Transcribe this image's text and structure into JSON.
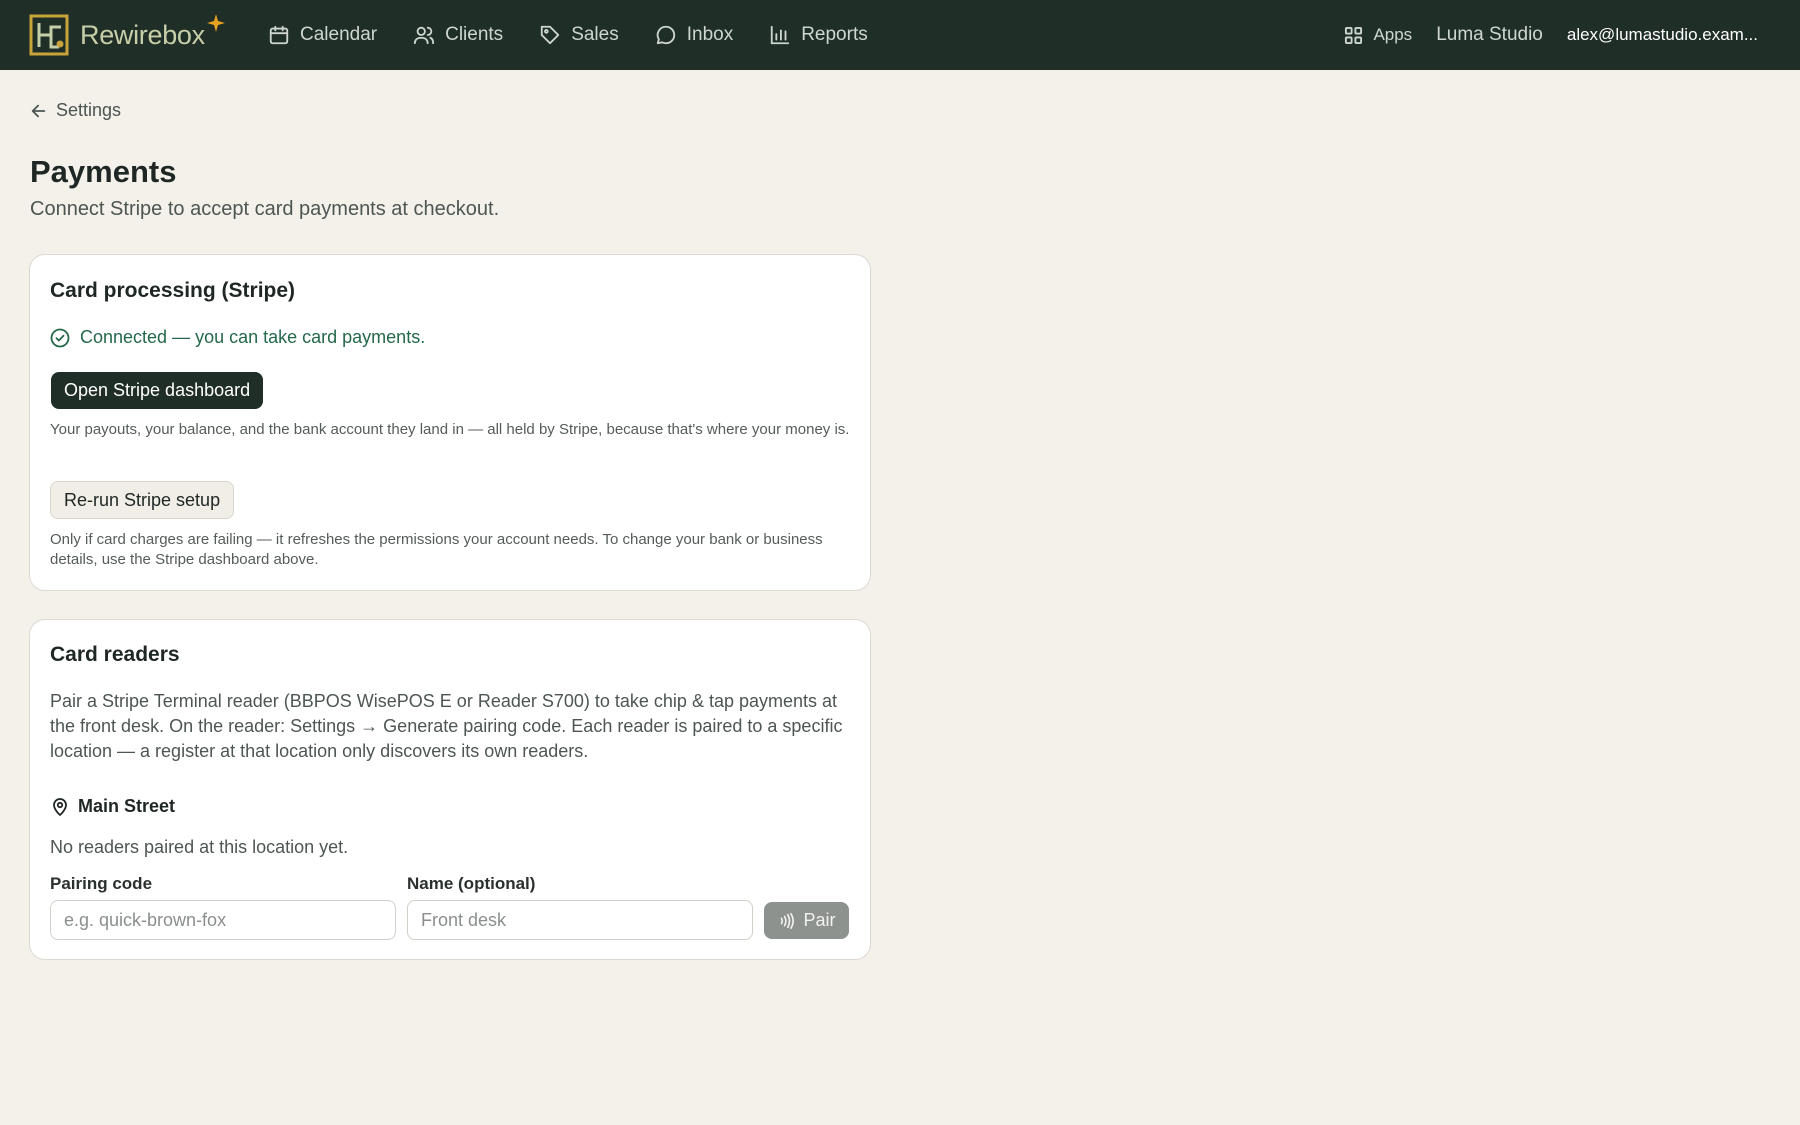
{
  "app": {
    "name": "Rewirebox",
    "colors": {
      "topbar": "#1f2e27",
      "accent_gold": "#e8a21f",
      "success": "#24684b",
      "background": "#f3f1ea"
    }
  },
  "nav": {
    "items": [
      {
        "label": "Calendar",
        "icon": "calendar-icon"
      },
      {
        "label": "Clients",
        "icon": "users-icon"
      },
      {
        "label": "Sales",
        "icon": "tag-icon"
      },
      {
        "label": "Inbox",
        "icon": "chat-bubble-icon"
      },
      {
        "label": "Reports",
        "icon": "bar-chart-icon"
      }
    ],
    "apps_label": "Apps",
    "studio": "Luma Studio",
    "user_email": "alex@lumastudio.exam..."
  },
  "page": {
    "back_label": "Settings",
    "title": "Payments",
    "subtitle": "Connect Stripe to accept card payments at checkout."
  },
  "card_processing": {
    "title": "Card processing (Stripe)",
    "status": "Connected — you can take card payments.",
    "dashboard_button": "Open Stripe dashboard",
    "dashboard_hint": "Your payouts, your balance, and the bank account they land in — all held by Stripe, because that's where your money is.",
    "rerun_button": "Re-run Stripe setup",
    "rerun_hint": "Only if card charges are failing — it refreshes the permissions your account needs. To change your bank or business details, use the Stripe dashboard above."
  },
  "card_readers": {
    "title": "Card readers",
    "description": "Pair a Stripe Terminal reader (BBPOS WisePOS E or Reader S700) to take chip & tap payments at the front desk. On the reader: Settings → Generate pairing code. Each reader is paired to a specific location — a register at that location only discovers its own readers.",
    "location": "Main Street",
    "empty_text": "No readers paired at this location yet.",
    "pairing_code_label": "Pairing code",
    "pairing_code_placeholder": "e.g. quick-brown-fox",
    "name_label": "Name (optional)",
    "name_placeholder": "Front desk",
    "pair_button": "Pair"
  }
}
